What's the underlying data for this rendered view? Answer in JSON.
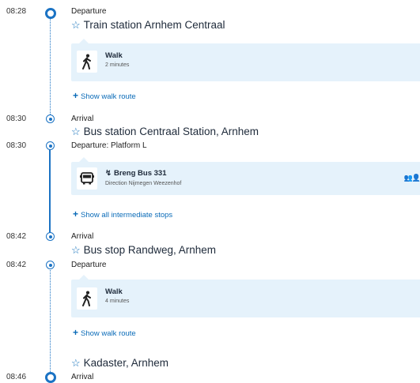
{
  "colors": {
    "accent": "#1b73c4",
    "link": "#0a6bb8",
    "card_bg": "#e5f2fb",
    "text": "#1e2a3a"
  },
  "segments": [
    {
      "time": "08:28",
      "label": "Departure",
      "stop": "Train station Arnhem Centraal"
    },
    {
      "mode": "Walk",
      "detail": "2 minutes",
      "icon": "walking-person-icon",
      "link": "Show walk route"
    },
    {
      "time": "08:30",
      "label": "Arrival",
      "stop": "Bus station Centraal Station, Arnhem"
    },
    {
      "time": "08:30",
      "label": "Departure: Platform L"
    },
    {
      "mode": "Breng Bus 331",
      "detail": "Direction Nijmegen Weezenhof",
      "icon": "bus-icon",
      "operator_icon": "lightning-icon",
      "crowd_icon": "crowd-people-icon",
      "link": "Show all intermediate stops"
    },
    {
      "time": "08:42",
      "label": "Arrival",
      "stop": "Bus stop Randweg, Arnhem"
    },
    {
      "time": "08:42",
      "label": "Departure"
    },
    {
      "mode": "Walk",
      "detail": "4 minutes",
      "icon": "walking-person-icon",
      "link": "Show walk route"
    },
    {
      "stop": "Kadaster, Arnhem"
    },
    {
      "time": "08:46",
      "label": "Arrival"
    }
  ]
}
